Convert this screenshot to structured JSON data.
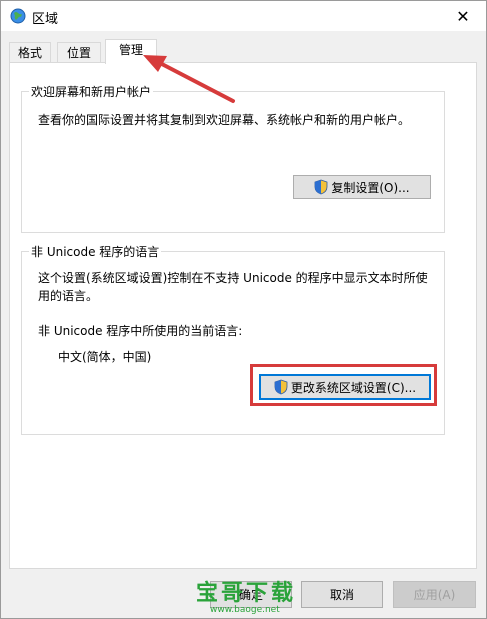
{
  "window": {
    "title": "区域",
    "close_glyph": "✕"
  },
  "tabs": [
    {
      "label": "格式",
      "active": false
    },
    {
      "label": "位置",
      "active": false
    },
    {
      "label": "管理",
      "active": true
    }
  ],
  "welcome_group": {
    "legend": "欢迎屏幕和新用户帐户",
    "description": "查看你的国际设置并将其复制到欢迎屏幕、系统帐户和新的用户帐户。",
    "copy_button": "复制设置(O)..."
  },
  "unicode_group": {
    "legend": "非 Unicode 程序的语言",
    "description_line1": "这个设置(系统区域设置)控制在不支持 Unicode 的程序中显示文本时所使",
    "description_line2": "用的语言。",
    "current_label": "非 Unicode 程序中所使用的当前语言:",
    "current_value": "中文(简体，中国)",
    "change_button": "更改系统区域设置(C)..."
  },
  "footer": {
    "ok_button": "确定",
    "cancel_button": "取消",
    "apply_button": "应用(A)"
  },
  "watermark": {
    "main": "宝哥下载",
    "url": "www.baoge.net"
  },
  "colors": {
    "highlight": "#d63b3b",
    "accent": "#0078d7",
    "watermark": "#2aa33a"
  }
}
